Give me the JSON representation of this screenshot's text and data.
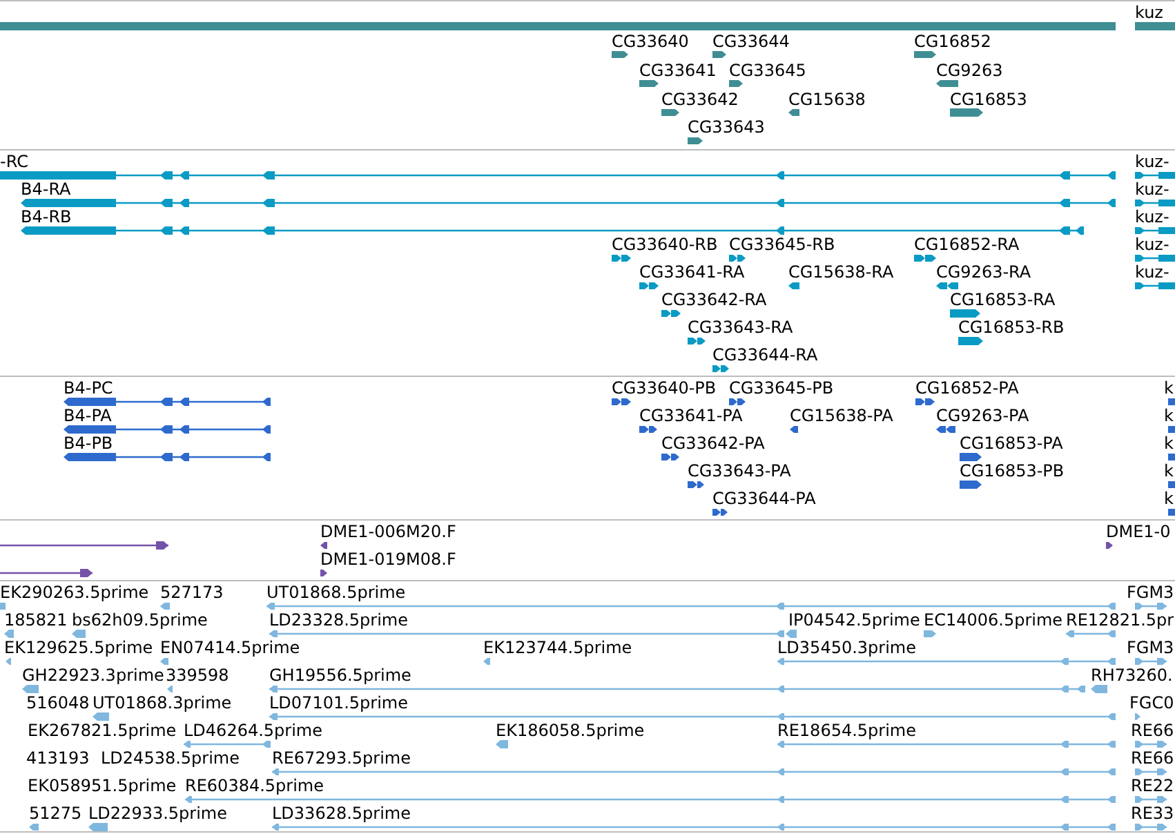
{
  "tracks": [
    {
      "kind": "gene",
      "features": [
        {
          "label": "kuz",
          "reverse": false
        },
        {
          "reverse": true
        },
        {
          "label": "CG33640",
          "reverse": false
        },
        {
          "label": "CG33644",
          "reverse": false
        },
        {
          "label": "CG16852",
          "reverse": false
        },
        {
          "label": "CG33641",
          "reverse": false
        },
        {
          "label": "CG33645",
          "reverse": false
        },
        {
          "label": "CG9263",
          "reverse": true
        },
        {
          "label": "CG33642",
          "reverse": false
        },
        {
          "label": "CG15638",
          "reverse": true
        },
        {
          "label": "CG16853",
          "reverse": false
        },
        {
          "label": "CG33643",
          "reverse": false
        }
      ]
    },
    {
      "kind": "transcript",
      "features": [
        {
          "label": "-RC",
          "reverse": true
        },
        {
          "label": "kuz-",
          "reverse": false
        },
        {
          "label": "B4-RA",
          "reverse": true
        },
        {
          "label": "kuz-",
          "reverse": false
        },
        {
          "label": "B4-RB",
          "reverse": true
        },
        {
          "label": "kuz-",
          "reverse": false
        },
        {
          "label": "CG33640-RB",
          "reverse": false
        },
        {
          "label": "CG33645-RB",
          "reverse": false
        },
        {
          "label": "CG16852-RA",
          "reverse": false
        },
        {
          "label": "kuz-",
          "reverse": false
        },
        {
          "label": "CG33641-RA",
          "reverse": false
        },
        {
          "label": "CG15638-RA",
          "reverse": true
        },
        {
          "label": "CG9263-RA",
          "reverse": true
        },
        {
          "label": "kuz-",
          "reverse": false
        },
        {
          "label": "CG33642-RA",
          "reverse": false
        },
        {
          "label": "CG16853-RA",
          "reverse": false
        },
        {
          "label": "CG33643-RA",
          "reverse": false
        },
        {
          "label": "CG16853-RB",
          "reverse": false
        },
        {
          "label": "CG33644-RA",
          "reverse": false
        }
      ]
    },
    {
      "kind": "protein",
      "features": [
        {
          "label": "B4-PC",
          "reverse": true
        },
        {
          "label": "CG33640-PB",
          "reverse": false
        },
        {
          "label": "CG33645-PB",
          "reverse": false
        },
        {
          "label": "CG16852-PA",
          "reverse": false
        },
        {
          "label": "k",
          "reverse": false
        },
        {
          "label": "B4-PA",
          "reverse": true
        },
        {
          "label": "CG33641-PA",
          "reverse": false
        },
        {
          "label": "CG15638-PA",
          "reverse": true
        },
        {
          "label": "CG9263-PA",
          "reverse": true
        },
        {
          "label": "k",
          "reverse": false
        },
        {
          "label": "B4-PB",
          "reverse": true
        },
        {
          "label": "CG33642-PA",
          "reverse": false
        },
        {
          "label": "CG16853-PA",
          "reverse": false
        },
        {
          "label": "k",
          "reverse": false
        },
        {
          "label": "CG33643-PA",
          "reverse": false
        },
        {
          "label": "CG16853-PB",
          "reverse": false
        },
        {
          "label": "k",
          "reverse": false
        },
        {
          "label": "CG33644-PA",
          "reverse": false
        },
        {
          "label": "k",
          "reverse": false
        }
      ]
    },
    {
      "kind": "clone_end",
      "features": [
        {
          "reverse": false
        },
        {
          "label": "DME1-006M20.F",
          "reverse": true
        },
        {
          "label": "DME1-0",
          "reverse": false
        },
        {
          "reverse": false
        },
        {
          "label": "DME1-019M08.F",
          "reverse": false
        }
      ]
    },
    {
      "kind": "est",
      "features": [
        {
          "label": "EK290263.5prime",
          "reverse": true
        },
        {
          "label": "527173",
          "reverse": true
        },
        {
          "label": "UT01868.5prime",
          "reverse": true
        },
        {
          "label": "FGM3",
          "reverse": false
        },
        {
          "label": "185821",
          "reverse": true
        },
        {
          "label": "bs62h09.5prime",
          "reverse": true
        },
        {
          "label": "LD23328.5prime",
          "reverse": true
        },
        {
          "label": "IP04542.5prime",
          "reverse": true
        },
        {
          "label": "EC14006.5prime",
          "reverse": false
        },
        {
          "label": "RE12821.5pr",
          "reverse": true
        },
        {
          "label": "EK129625.5prime",
          "reverse": true
        },
        {
          "label": "EN07414.5prime",
          "reverse": true
        },
        {
          "label": "EK123744.5prime",
          "reverse": true
        },
        {
          "label": "LD35450.3prime",
          "reverse": true
        },
        {
          "label": "FGM3",
          "reverse": false
        },
        {
          "label": "GH22923.3prime",
          "reverse": true
        },
        {
          "label": "339598",
          "reverse": true
        },
        {
          "label": "GH19556.5prime",
          "reverse": true
        },
        {
          "label": "RH73260.",
          "reverse": true
        },
        {
          "label": "516048"
        },
        {
          "label": "UT01868.3prime",
          "reverse": true
        },
        {
          "label": "LD07101.5prime",
          "reverse": true
        },
        {
          "label": "FGC0",
          "reverse": false
        },
        {
          "label": "EK267821.5prime"
        },
        {
          "label": "LD46264.5prime",
          "reverse": true
        },
        {
          "label": "EK186058.5prime",
          "reverse": true
        },
        {
          "label": "RE18654.5prime",
          "reverse": true
        },
        {
          "label": "RE66",
          "reverse": false
        },
        {
          "label": "413193"
        },
        {
          "label": "LD24538.5prime"
        },
        {
          "label": "RE67293.5prime",
          "reverse": true
        },
        {
          "label": "RE66",
          "reverse": false
        },
        {
          "label": "EK058951.5prime"
        },
        {
          "label": "RE60384.5prime",
          "reverse": true
        },
        {
          "label": "RE22",
          "reverse": false
        },
        {
          "label": "51275",
          "reverse": true
        },
        {
          "label": "LD22933.5prime",
          "reverse": true
        },
        {
          "label": "LD33628.5prime",
          "reverse": true
        },
        {
          "label": "RE33",
          "reverse": false
        }
      ]
    }
  ]
}
